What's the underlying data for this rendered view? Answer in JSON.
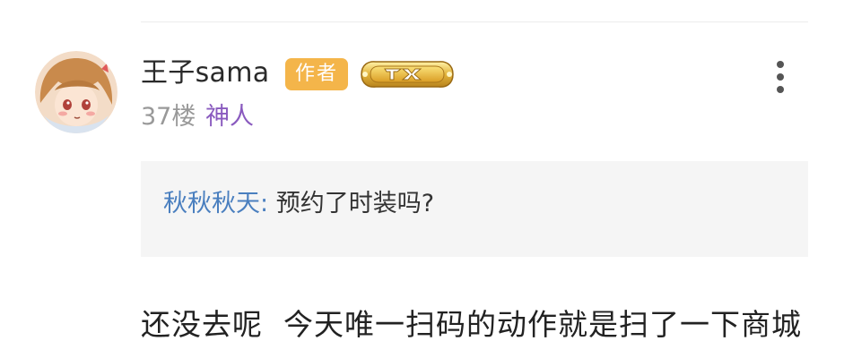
{
  "post": {
    "username": "王子sama",
    "author_badge": "作者",
    "level_badge_icon": "level-shield-icon",
    "floor": "37楼",
    "rank": "神人",
    "more_icon": "more-vertical-icon",
    "quote": {
      "author": "秋秋秋天:",
      "text": "预约了时装吗?"
    },
    "body": "还没去呢  今天唯一扫码的动作就是扫了一下商城"
  },
  "colors": {
    "author_badge_bg": "#f4b54a",
    "rank_text": "#8a5bbf",
    "quote_author": "#4a7fbf",
    "quote_bg": "#f5f5f5",
    "secondary_text": "#999999"
  }
}
